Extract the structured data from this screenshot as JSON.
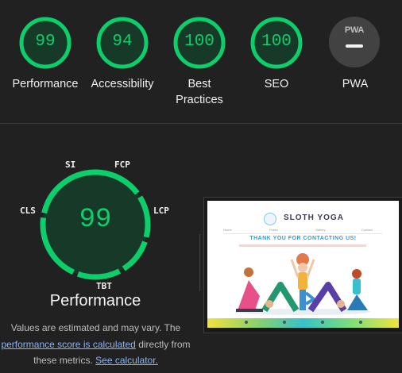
{
  "categories": [
    {
      "key": "performance",
      "score": "99",
      "label": "Performance",
      "color": "#0cce6b"
    },
    {
      "key": "accessibility",
      "score": "94",
      "label": "Accessibility",
      "color": "#0cce6b"
    },
    {
      "key": "best-practices",
      "score": "100",
      "label": "Best Practices",
      "color": "#0cce6b"
    },
    {
      "key": "seo",
      "score": "100",
      "label": "SEO",
      "color": "#0cce6b"
    },
    {
      "key": "pwa",
      "score": "PWA",
      "label": "PWA",
      "color": "#9e9e9e"
    }
  ],
  "performance": {
    "score": "99",
    "title": "Performance",
    "metrics": [
      "SI",
      "FCP",
      "LCP",
      "TBT",
      "CLS"
    ],
    "note_prefix": "Values are estimated and may vary. The",
    "note_link1": "performance score is calculated",
    "note_mid": "directly from these metrics.",
    "note_link2": "See calculator."
  },
  "screenshot": {
    "brand": "SLOTH YOGA",
    "heading": "THANK YOU FOR CONTACTING US!",
    "nav": [
      "Home",
      "Poses",
      "Gallery",
      "Contact"
    ]
  },
  "colors": {
    "pass": "#0cce6b",
    "background": "#212121",
    "link": "#8ab4f8"
  }
}
